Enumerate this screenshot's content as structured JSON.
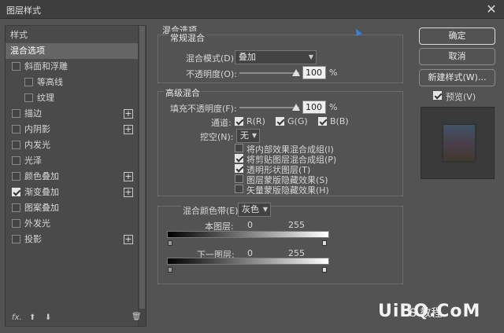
{
  "window": {
    "title": "图层样式",
    "close": "✕"
  },
  "sidebar": {
    "heading": "样式",
    "items": [
      {
        "label": "混合选项",
        "selected": true,
        "checkbox": false,
        "checked": false,
        "plus": false
      },
      {
        "label": "斜面和浮雕",
        "checkbox": true,
        "checked": false,
        "plus": false
      },
      {
        "label": "等高线",
        "checkbox": true,
        "checked": false,
        "plus": false
      },
      {
        "label": "纹理",
        "checkbox": true,
        "checked": false,
        "plus": false
      },
      {
        "label": "描边",
        "checkbox": true,
        "checked": false,
        "plus": true
      },
      {
        "label": "内阴影",
        "checkbox": true,
        "checked": false,
        "plus": true
      },
      {
        "label": "内发光",
        "checkbox": true,
        "checked": false,
        "plus": false
      },
      {
        "label": "光泽",
        "checkbox": true,
        "checked": false,
        "plus": false
      },
      {
        "label": "颜色叠加",
        "checkbox": true,
        "checked": false,
        "plus": true
      },
      {
        "label": "渐变叠加",
        "checkbox": true,
        "checked": true,
        "plus": true
      },
      {
        "label": "图案叠加",
        "checkbox": true,
        "checked": false,
        "plus": false
      },
      {
        "label": "外发光",
        "checkbox": true,
        "checked": false,
        "plus": false
      },
      {
        "label": "投影",
        "checkbox": true,
        "checked": false,
        "plus": true
      }
    ],
    "footer": {
      "fx": "fx.",
      "up": "⬆",
      "down": "⬇",
      "trash": "🗑"
    }
  },
  "blend": {
    "section_title": "混合选项",
    "general_title": "常规混合",
    "mode_label": "混合模式(D):",
    "mode_value": "叠加",
    "opacity_label": "不透明度(O):",
    "opacity_value": "100",
    "percent": "%",
    "advanced_title": "高级混合",
    "fill_label": "填充不透明度(F):",
    "fill_value": "100",
    "channels_label": "通道:",
    "channel_r": "R(R)",
    "channel_g": "G(G)",
    "channel_b": "B(B)",
    "knockout_label": "挖空(N):",
    "knockout_value": "无",
    "options": [
      {
        "label": "将内部效果混合成组(I)",
        "checked": false
      },
      {
        "label": "将剪贴图层混合成组(P)",
        "checked": true
      },
      {
        "label": "透明形状图层(T)",
        "checked": true
      },
      {
        "label": "图层蒙版隐藏效果(S)",
        "checked": false
      },
      {
        "label": "矢量蒙版隐藏效果(H)",
        "checked": false
      }
    ],
    "blend_if_label": "混合颜色带(E):",
    "blend_if_value": "灰色",
    "this_layer_label": "本图层:",
    "this_layer_min": "0",
    "this_layer_max": "255",
    "under_layer_label": "下一图层:",
    "under_layer_min": "0",
    "under_layer_max": "255"
  },
  "buttons": {
    "ok": "确定",
    "cancel": "取消",
    "new_style": "新建样式(W)...",
    "preview": "预览(V)"
  },
  "watermark": {
    "text": "UiBQ.CoM",
    "small": "S  教程"
  }
}
